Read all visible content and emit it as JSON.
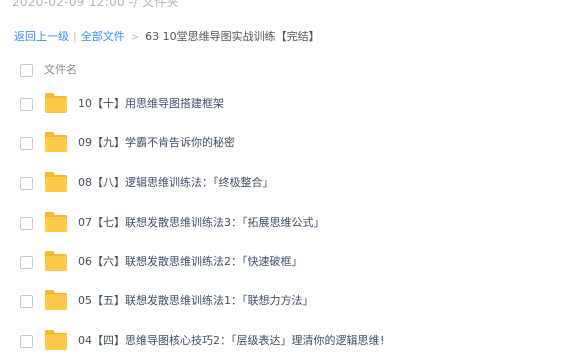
{
  "top_text": "2020-02-09 12:00   -/ 文件夹",
  "breadcrumb": {
    "back": "返回上一级",
    "separator": "|",
    "all_files": "全部文件",
    "chevron": ">",
    "current": "63 10堂思维导图实战训练【完结】"
  },
  "list_header": {
    "column_name": "文件名"
  },
  "folder_color": "#ffc94a",
  "folder_tab_color": "#f5b82e",
  "files": [
    {
      "name": "10【十】用思维导图搭建框架"
    },
    {
      "name": "09【九】学霸不肯告诉你的秘密"
    },
    {
      "name": "08【八】逻辑思维训练法：「终极整合」"
    },
    {
      "name": "07【七】联想发散思维训练法3：「拓展思维公式」"
    },
    {
      "name": "06【六】联想发散思维训练法2：「快速破框」"
    },
    {
      "name": "05【五】联想发散思维训练法1：「联想力方法」"
    },
    {
      "name": "04【四】思维导图核心技巧2：「层级表达」理清你的逻辑思维！"
    }
  ]
}
